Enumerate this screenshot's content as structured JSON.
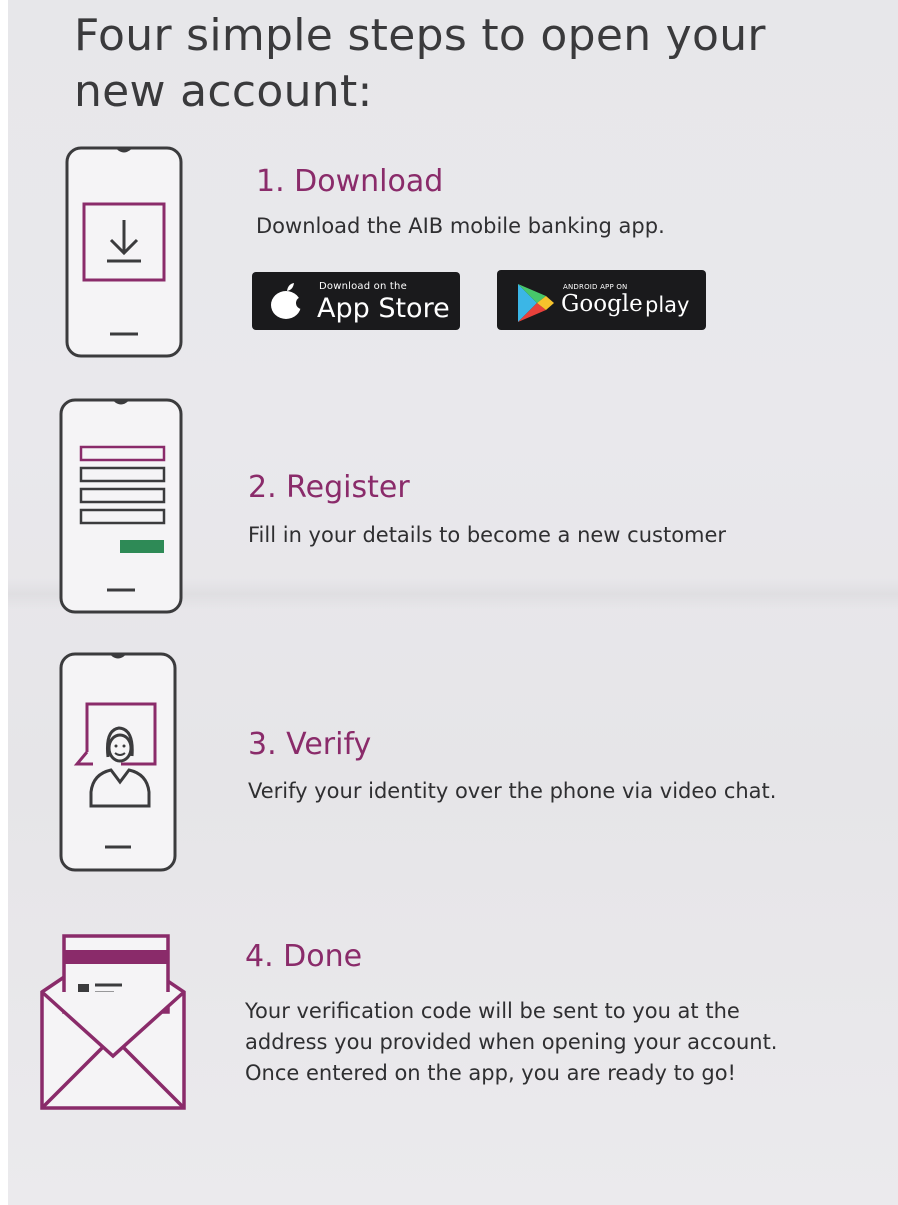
{
  "headline": "Four simple steps to open your new account:",
  "colors": {
    "accent": "#8a2b6a",
    "icon_stroke": "#3b3b3d",
    "submit_green": "#2e8a56",
    "badge_background": "#1a1a1c",
    "paper": "#e8e7ea"
  },
  "steps": [
    {
      "title": "1. Download",
      "description": "Download the AIB mobile banking app.",
      "icon": "phone-download-icon"
    },
    {
      "title": "2. Register",
      "description": "Fill in your details to become a new customer",
      "icon": "phone-form-icon"
    },
    {
      "title": "3. Verify",
      "description": "Verify your identity over the phone via video chat.",
      "icon": "phone-video-chat-icon"
    },
    {
      "title": "4. Done",
      "description": "Your verification code will be sent to you at the address you provided when opening your account. Once entered on the app, you are ready to go!",
      "icon": "envelope-letter-icon"
    }
  ],
  "badges": {
    "app_store": {
      "small_text": "Download on the",
      "big_text": "App Store",
      "icon": "apple-icon"
    },
    "google_play": {
      "small_text": "ANDROID APP ON",
      "brand_text": "Google",
      "big_text": "play",
      "icon": "play-triangle-icon"
    }
  }
}
